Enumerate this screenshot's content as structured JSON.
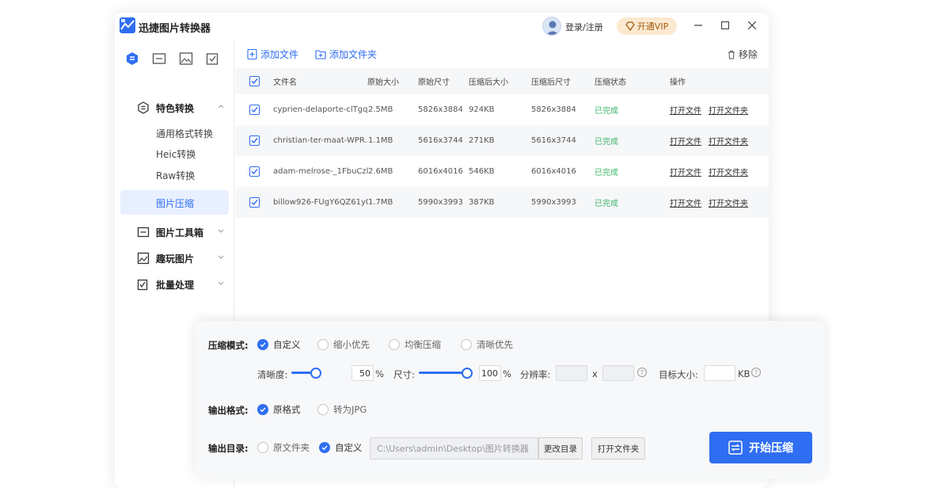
{
  "app": {
    "title": "迅捷图片转换器",
    "login_label": "登录/注册",
    "vip_label": "开通VIP"
  },
  "toolbar": {
    "add_file": "添加文件",
    "add_folder": "添加文件夹",
    "remove": "移除"
  },
  "sidebar": {
    "groups": [
      {
        "label": "特色转换",
        "icon": "convert-icon"
      },
      {
        "label": "图片工具箱",
        "icon": "toolbox-icon"
      },
      {
        "label": "趣玩图片",
        "icon": "fun-image-icon"
      },
      {
        "label": "批量处理",
        "icon": "batch-icon"
      }
    ],
    "items": [
      "通用格式转换",
      "Heic转换",
      "Raw转换",
      "图片压缩"
    ],
    "active_item": "图片压缩"
  },
  "table": {
    "headers": [
      "文件名",
      "原始大小",
      "原始尺寸",
      "压缩后大小",
      "压缩后尺寸",
      "压缩状态",
      "操作"
    ],
    "rows": [
      {
        "name": "cyprien-delaporte-clTgqi...",
        "orig_size": "2.5MB",
        "orig_dim": "5826x3884",
        "new_size": "924KB",
        "new_dim": "5826x3884",
        "status": "已完成",
        "open_file": "打开文件",
        "open_folder": "打开文件夹"
      },
      {
        "name": "christian-ter-maat-WPR...",
        "orig_size": "1.1MB",
        "orig_dim": "5616x3744",
        "new_size": "271KB",
        "new_dim": "5616x3744",
        "status": "已完成",
        "open_file": "打开文件",
        "open_folder": "打开文件夹"
      },
      {
        "name": "adam-melrose-_1FbuCzl...",
        "orig_size": "2.6MB",
        "orig_dim": "6016x4016",
        "new_size": "546KB",
        "new_dim": "6016x4016",
        "status": "已完成",
        "open_file": "打开文件",
        "open_folder": "打开文件夹"
      },
      {
        "name": "billow926-FUgY6QZ61y0...",
        "orig_size": "1.7MB",
        "orig_dim": "5990x3993",
        "new_size": "387KB",
        "new_dim": "5990x3993",
        "status": "已完成",
        "open_file": "打开文件",
        "open_folder": "打开文件夹"
      }
    ]
  },
  "settings": {
    "mode_label": "压缩模式:",
    "modes": [
      "自定义",
      "缩小优先",
      "均衡压缩",
      "清晰优先"
    ],
    "mode_selected": "自定义",
    "clarity_label": "清晰度:",
    "clarity_value": "50",
    "clarity_level": 0.5,
    "size_label": "尺寸:",
    "size_value": "100",
    "size_level": 1.0,
    "percent": "%",
    "resolution_label": "分辨率:",
    "x_sep": "x",
    "target_label": "目标大小:",
    "target_unit": "KB",
    "format_label": "输出格式:",
    "formats": [
      "原格式",
      "转为JPG"
    ],
    "format_selected": "原格式",
    "dir_label": "输出目录:",
    "dirs": [
      "原文件夹",
      "自定义"
    ],
    "dir_selected": "自定义",
    "path_value": "C:\\Users\\admin\\Desktop\\图片转换器",
    "change_dir": "更改目录",
    "open_folder": "打开文件夹",
    "start": "开始压缩"
  },
  "colors": {
    "accent": "#2f6ef2",
    "done": "#3bb56a",
    "vip_bg": "#fde9cf"
  }
}
